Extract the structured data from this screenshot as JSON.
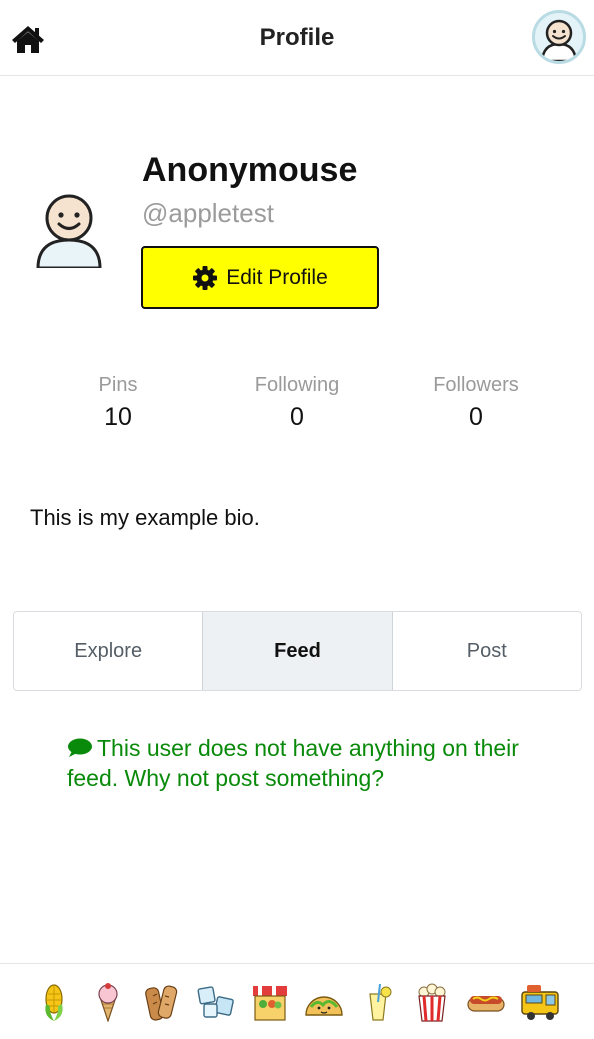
{
  "header": {
    "title": "Profile"
  },
  "profile": {
    "display_name": "Anonymouse",
    "handle": "@appletest",
    "edit_label": "Edit Profile",
    "bio": "This is my example bio."
  },
  "stats": [
    {
      "label": "Pins",
      "value": "10"
    },
    {
      "label": "Following",
      "value": "0"
    },
    {
      "label": "Followers",
      "value": "0"
    }
  ],
  "tabs": [
    {
      "label": "Explore",
      "active": false
    },
    {
      "label": "Feed",
      "active": true
    },
    {
      "label": "Post",
      "active": false
    }
  ],
  "feed": {
    "empty_message": "This user does not have anything on their feed. Why not post something?"
  },
  "bottom_nav": {
    "icons": [
      "corn-icon",
      "ice-cream-icon",
      "baguette-icon",
      "ice-cubes-icon",
      "market-stall-icon",
      "taco-icon",
      "lemonade-icon",
      "popcorn-icon",
      "hot-dog-icon",
      "food-truck-icon"
    ]
  },
  "colors": {
    "edit_button": "#ffff00",
    "message_green": "#0a8a0a",
    "handle_gray": "#9b9b9b",
    "active_tab_bg": "#eef1f3"
  }
}
